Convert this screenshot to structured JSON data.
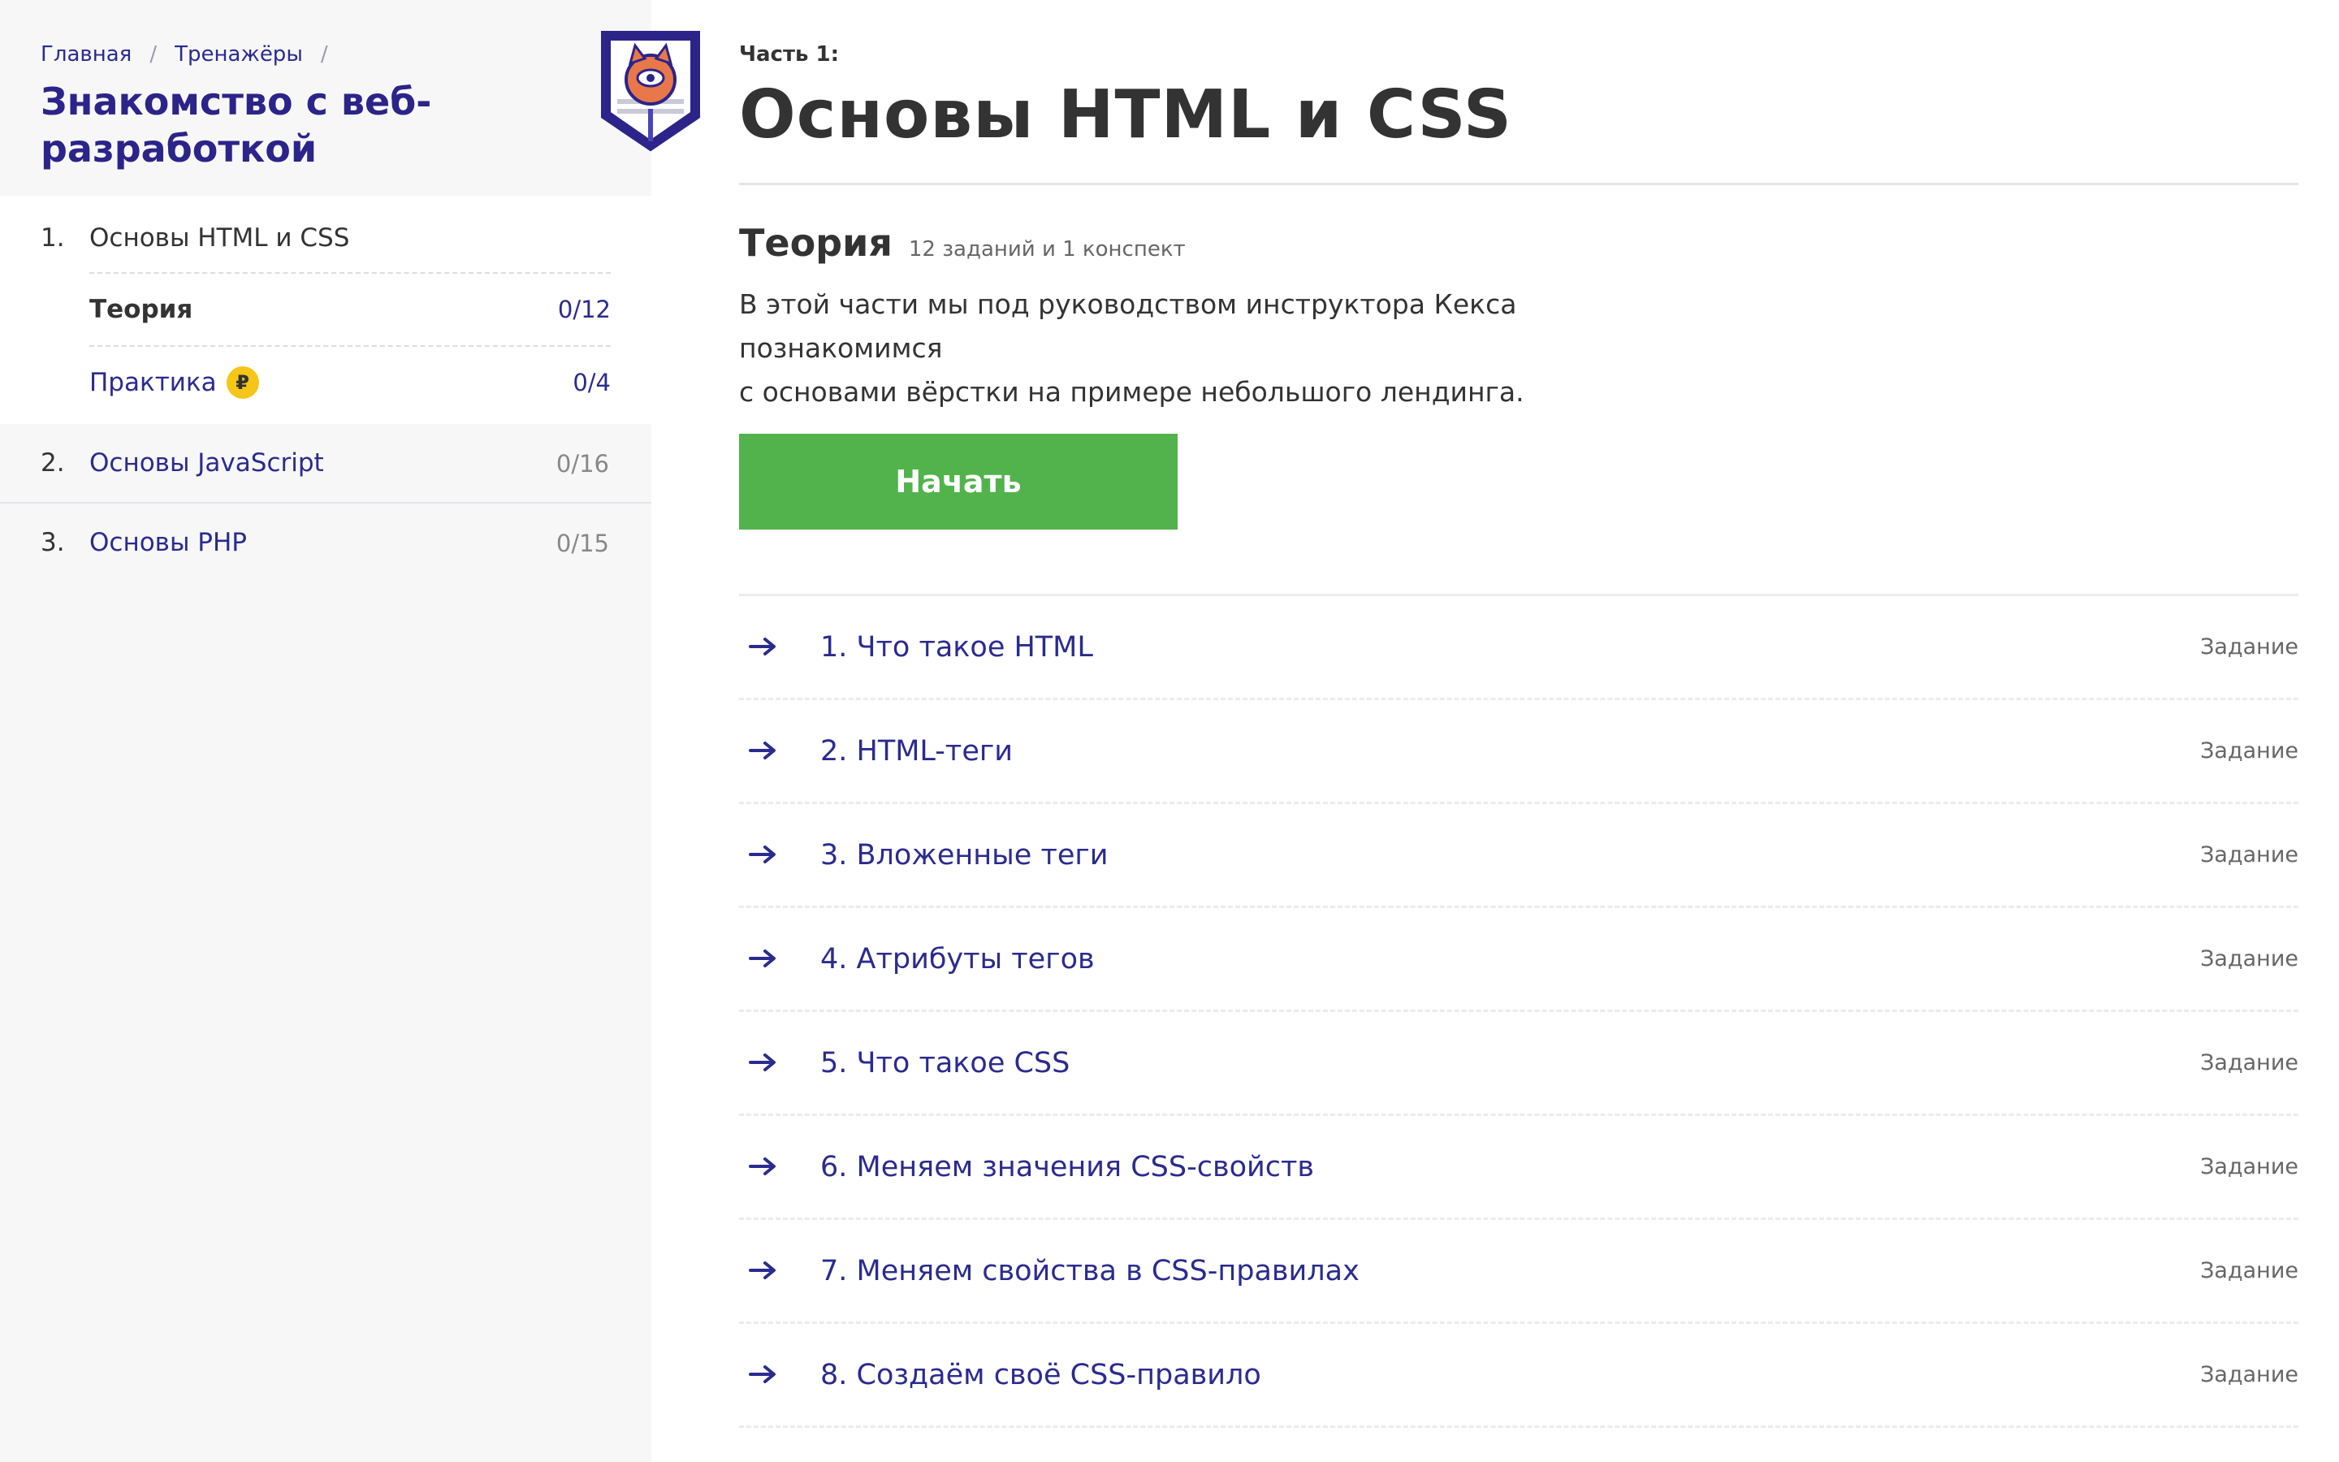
{
  "breadcrumb": {
    "home": "Главная",
    "trainers": "Тренажёры",
    "sep": "/"
  },
  "course": {
    "title": "Знакомство с веб-разработкой"
  },
  "sections": [
    {
      "num": "1.",
      "label": "Основы HTML и CSS",
      "active": true,
      "subs": [
        {
          "label": "Теория",
          "count": "0/12"
        },
        {
          "label": "Практика",
          "count": "0/4",
          "badge": "₽"
        }
      ]
    },
    {
      "num": "2.",
      "label": "Основы JavaScript",
      "count": "0/16"
    },
    {
      "num": "3.",
      "label": "Основы PHP",
      "count": "0/15"
    }
  ],
  "part": {
    "label": "Часть 1:",
    "title": "Основы HTML и CSS",
    "theory_title": "Теория",
    "theory_meta": "12 заданий и 1 конспект",
    "description_line1": "В этой части мы под руководством инструктора Кекса познакомимся",
    "description_line2": "с основами вёрстки на примере небольшого лендинга.",
    "start_label": "Начать"
  },
  "tasks": [
    {
      "label": "1. Что такое HTML",
      "type": "Задание"
    },
    {
      "label": "2. HTML-теги",
      "type": "Задание"
    },
    {
      "label": "3. Вложенные теги",
      "type": "Задание"
    },
    {
      "label": "4. Атрибуты тегов",
      "type": "Задание"
    },
    {
      "label": "5. Что такое CSS",
      "type": "Задание"
    },
    {
      "label": "6. Меняем значения CSS-свойств",
      "type": "Задание"
    },
    {
      "label": "7. Меняем свойства в CSS-правилах",
      "type": "Задание"
    },
    {
      "label": "8. Создаём своё CSS-правило",
      "type": "Задание"
    }
  ],
  "icons": {
    "logo": "detective-cat-shield-logo",
    "arrow": "arrow-right-icon",
    "badge": "ruble-coin-icon"
  },
  "colors": {
    "accent": "#2b2b8f",
    "button": "#52b34d",
    "coin": "#f5c518",
    "sidebar_bg": "#f7f7f8"
  }
}
